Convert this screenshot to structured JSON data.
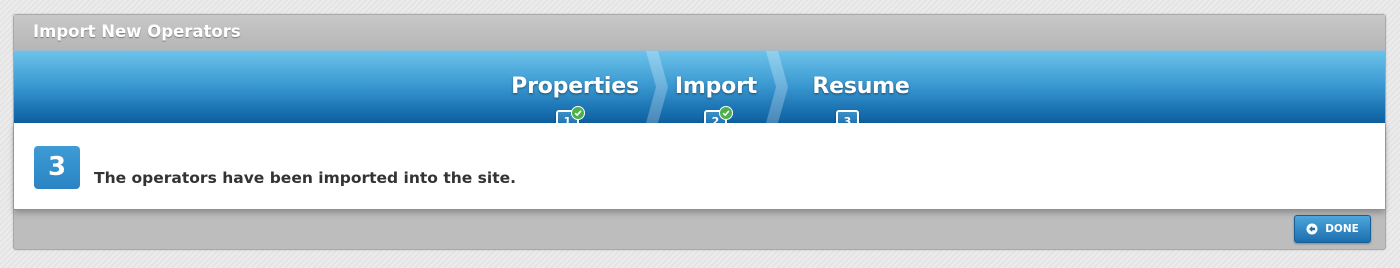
{
  "dialog": {
    "title": "Import New Operators"
  },
  "wizard": {
    "steps": [
      {
        "label": "Properties",
        "number": "1",
        "completed": true
      },
      {
        "label": "Import",
        "number": "2",
        "completed": true
      },
      {
        "label": "Resume",
        "number": "3",
        "completed": false
      }
    ],
    "current_step": "3"
  },
  "content": {
    "step_badge": "3",
    "message": "The operators have been imported into the site."
  },
  "footer": {
    "done_label": "DONE",
    "done_icon": "back-arrow-circle-icon"
  },
  "colors": {
    "accent": "#2a84c3",
    "check": "#4cb04c"
  }
}
